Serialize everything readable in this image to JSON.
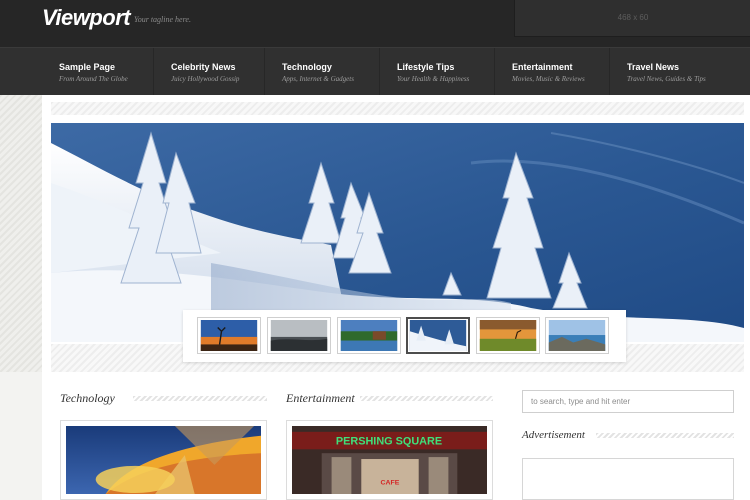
{
  "site": {
    "logo": "Viewport",
    "tagline": "Your tagline here."
  },
  "header_ad": {
    "label": "468 x 60"
  },
  "nav": {
    "items": [
      {
        "title": "Sample Page",
        "subtitle": "From Around The Globe"
      },
      {
        "title": "Celebrity News",
        "subtitle": "Juicy Hollywood Gossip"
      },
      {
        "title": "Technology",
        "subtitle": "Apps, Internet & Gadgets"
      },
      {
        "title": "Lifestyle Tips",
        "subtitle": "Your Health & Happiness"
      },
      {
        "title": "Entertainment",
        "subtitle": "Movies, Music & Reviews"
      },
      {
        "title": "Travel News",
        "subtitle": "Travel News, Guides & Tips"
      }
    ]
  },
  "slider": {
    "thumbnails": [
      {
        "icon": "sunset-tree-thumbnail"
      },
      {
        "icon": "misty-shore-thumbnail"
      },
      {
        "icon": "lake-cabin-thumbnail"
      },
      {
        "icon": "snowy-trees-thumbnail",
        "active": true
      },
      {
        "icon": "meadow-sunset-thumbnail"
      },
      {
        "icon": "coast-rocks-thumbnail"
      }
    ]
  },
  "sections": [
    {
      "title": "Technology"
    },
    {
      "title": "Entertainment"
    }
  ],
  "cards": {
    "entertainment_sign": "PERSHING SQUARE",
    "entertainment_cafe": "CAFE"
  },
  "sidebar": {
    "search_placeholder": "to search, type and hit enter",
    "ad_title": "Advertisement"
  },
  "colors": {
    "header_bg": "#262626",
    "nav_bg": "#303030",
    "sky_blue": "#2f5f9a",
    "snow": "#f2f5fa"
  }
}
